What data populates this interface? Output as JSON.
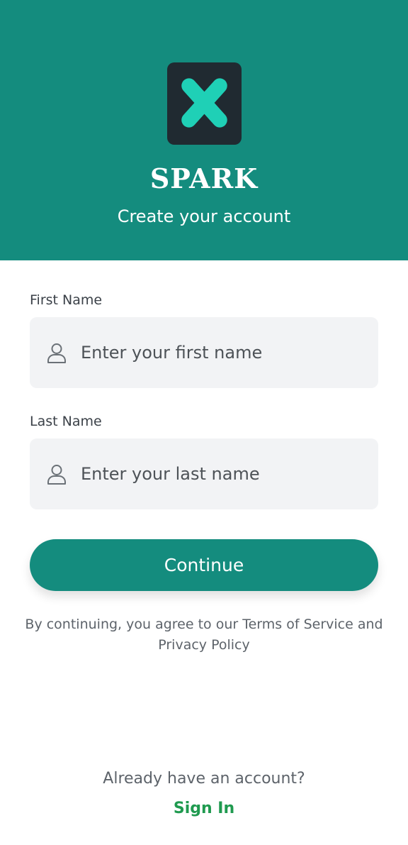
{
  "header": {
    "logo_icon": "x-logo-icon",
    "brand": "SPARK",
    "subtitle": "Create your account"
  },
  "form": {
    "first_name": {
      "label": "First Name",
      "placeholder": "Enter your first name",
      "value": "",
      "icon": "person-icon"
    },
    "last_name": {
      "label": "Last Name",
      "placeholder": "Enter your last name",
      "value": "",
      "icon": "person-icon"
    },
    "continue_label": "Continue",
    "terms_text": "By continuing, you agree to our Terms of Service and Privacy Policy"
  },
  "footer": {
    "already_text": "Already have an account?",
    "signin_label": "Sign In"
  },
  "colors": {
    "primary": "#148c7e",
    "logo_bg": "#202a31",
    "logo_accent": "#1fd0b6",
    "signin": "#1f9a4f",
    "field_bg": "#f2f3f5"
  }
}
